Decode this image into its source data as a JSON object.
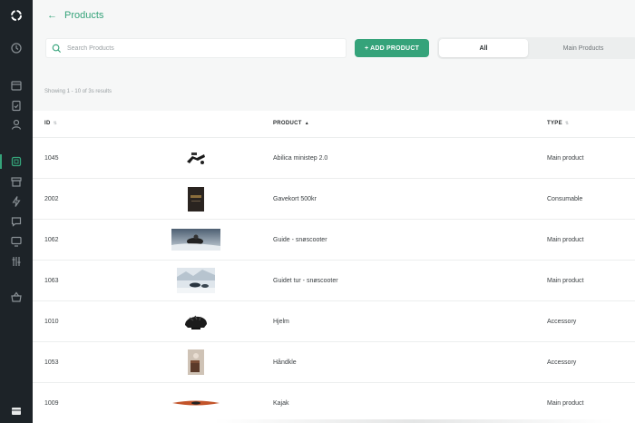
{
  "sidebar": {
    "items": [
      {
        "icon": "logo-ring-icon"
      },
      {
        "icon": "history-icon"
      },
      {
        "icon": "calendar-icon"
      },
      {
        "icon": "clipboard-check-icon"
      },
      {
        "icon": "user-icon"
      },
      {
        "icon": "product-box-icon",
        "active": true
      },
      {
        "icon": "archive-icon"
      },
      {
        "icon": "lightning-icon"
      },
      {
        "icon": "chat-icon"
      },
      {
        "icon": "monitor-icon"
      },
      {
        "icon": "sliders-icon"
      },
      {
        "icon": "basket-icon"
      },
      {
        "icon": "panel-icon"
      }
    ],
    "accent": "#35a37a",
    "background": "#1d2328"
  },
  "header": {
    "back_icon": "←",
    "title": "Products"
  },
  "search": {
    "placeholder": "Search Products",
    "value": ""
  },
  "toolbar": {
    "add_label": "+ ADD PRODUCT"
  },
  "filter_tabs": [
    {
      "label": "All",
      "selected": true
    },
    {
      "label": "Main Products",
      "selected": false
    }
  ],
  "results": {
    "text": "Showing 1 - 10 of 3s results"
  },
  "table": {
    "columns": [
      {
        "label": "ID",
        "sort": "none"
      },
      {
        "label": "PRODUCT",
        "sort": "asc"
      },
      {
        "label": "TYPE",
        "sort": "none"
      }
    ],
    "rows": [
      {
        "id": "1045",
        "image": "stepper-image",
        "name": "Abilica ministep 2.0",
        "type": "Main product"
      },
      {
        "id": "2002",
        "image": "gift-card-image",
        "name": "Gavekort 500kr",
        "type": "Consumable"
      },
      {
        "id": "1062",
        "image": "snowmobile-guide-image",
        "name": "Guide - snøscooter",
        "type": "Main product"
      },
      {
        "id": "1063",
        "image": "snowmobile-tour-image",
        "name": "Guidet tur - snøscooter",
        "type": "Main product"
      },
      {
        "id": "1010",
        "image": "helmet-image",
        "name": "Hjelm",
        "type": "Accessory"
      },
      {
        "id": "1053",
        "image": "towel-image",
        "name": "Håndkle",
        "type": "Accessory"
      },
      {
        "id": "1009",
        "image": "kayak-image",
        "name": "Kajak",
        "type": "Main product"
      }
    ]
  },
  "colors": {
    "accent": "#35a37a",
    "page_background": "#f6f7f7",
    "table_background": "#ffffff"
  }
}
